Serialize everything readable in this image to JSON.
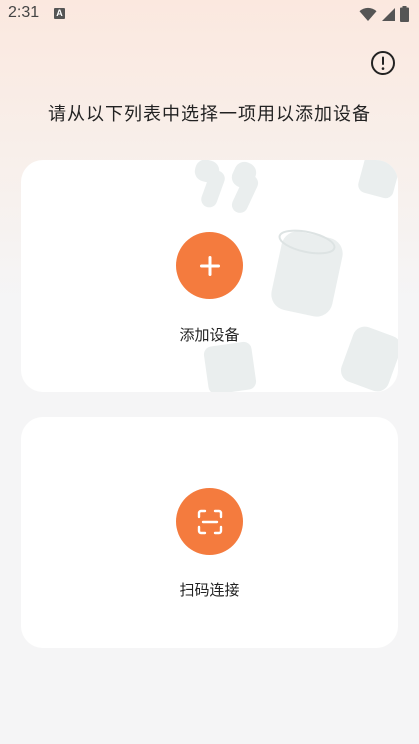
{
  "status_bar": {
    "time": "2:31",
    "badge": "A",
    "icons": [
      "wifi-icon",
      "signal-icon",
      "battery-icon"
    ]
  },
  "header": {
    "info_icon": "info-icon",
    "instruction": "请从以下列表中选择一项用以添加设备"
  },
  "cards": {
    "add_device": {
      "label": "添加设备",
      "icon": "plus-icon"
    },
    "scan_connect": {
      "label": "扫码连接",
      "icon": "scan-icon"
    }
  },
  "colors": {
    "accent": "#f47b3e",
    "card_bg": "#ffffff",
    "page_bg": "#f5f5f6",
    "gradient_top": "#fbe8df"
  }
}
